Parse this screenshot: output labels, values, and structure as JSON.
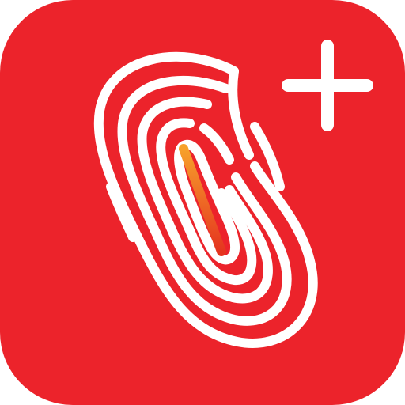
{
  "app_icon": {
    "name": "fingerprint-plus-app-icon",
    "symbol": "fingerprint-icon",
    "badge": "plus-icon",
    "colors": {
      "background": "#EC232B",
      "foreground": "#FFFFFF",
      "accent_start": "#F7A12B",
      "accent_end": "#E5341F"
    }
  }
}
